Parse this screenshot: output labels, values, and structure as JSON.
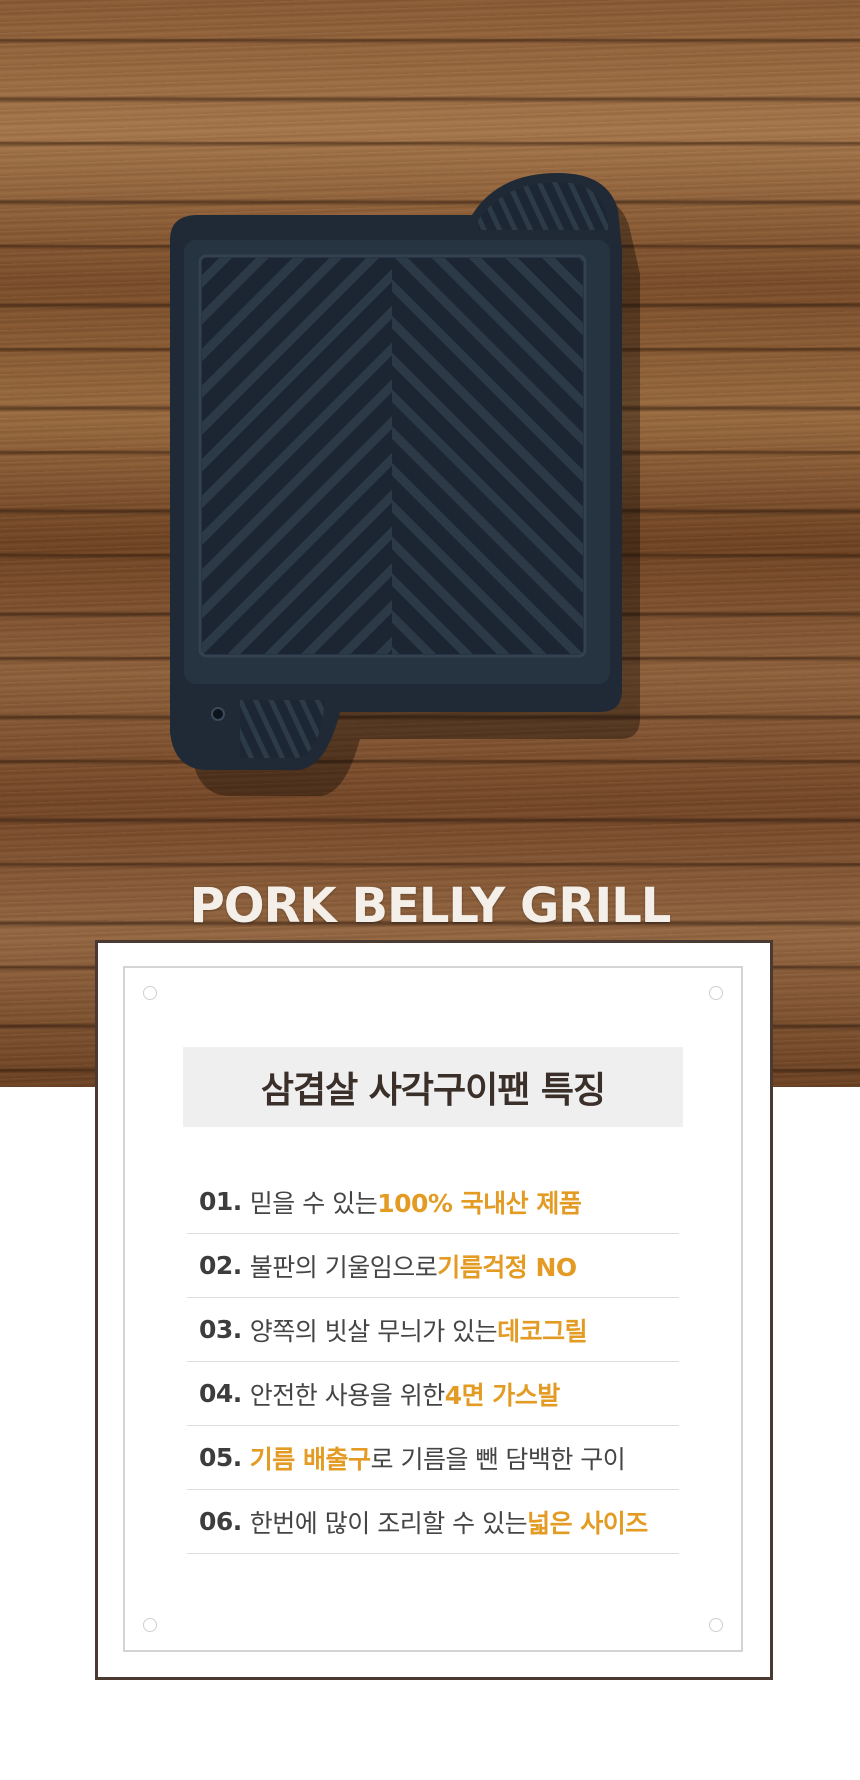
{
  "hero": {
    "title": "PORK BELLY GRILL",
    "product_image": "square-grill-pan"
  },
  "card": {
    "heading": "삼겹살 사각구이팬 특징",
    "features": [
      {
        "num": "01.",
        "pre": "믿을 수 있는 ",
        "hl": "100% 국내산 제품",
        "post": ""
      },
      {
        "num": "02.",
        "pre": "불판의 기울임으로 ",
        "hl": "기름걱정 NO",
        "post": ""
      },
      {
        "num": "03.",
        "pre": "양쪽의 빗살 무늬가 있는 ",
        "hl": "데코그릴",
        "post": ""
      },
      {
        "num": "04.",
        "pre": "안전한 사용을 위한 ",
        "hl": "4면 가스발",
        "post": ""
      },
      {
        "num": "05.",
        "pre": "",
        "hl": "기름 배출구",
        "post": "로 기름을 뺀 담백한 구이"
      },
      {
        "num": "06.",
        "pre": "한번에 많이 조리할 수 있는 ",
        "hl": "넓은 사이즈",
        "post": ""
      }
    ]
  },
  "colors": {
    "highlight": "#e39b23",
    "card_border": "#4b3a32",
    "heading_bg": "#efefef",
    "pan": "#1f2a36"
  }
}
